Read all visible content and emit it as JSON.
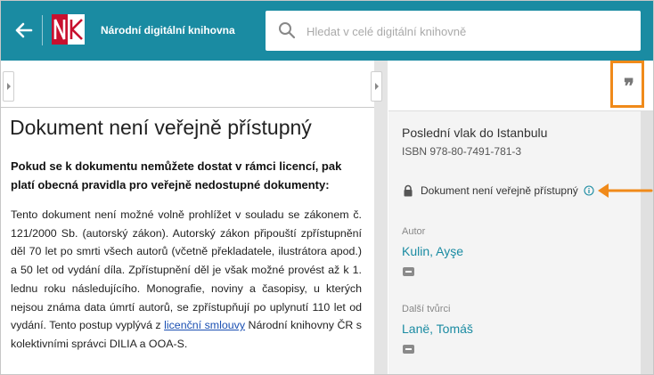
{
  "header": {
    "brand": "Národní digitální knihovna",
    "logo_text": "NK",
    "search_placeholder": "Hledat v celé digitální knihovně"
  },
  "document": {
    "title": "Dokument není veřejně přístupný",
    "intro": "Pokud se k dokumentu nemůžete dostat v rámci licencí, pak platí obecná pravidla pro veřejně nedostupné dokumenty:",
    "body_before_link": "Tento dokument není možné volně prohlížet v souladu se zákonem č. 121/2000 Sb. (autorský zákon). Autorský zákon připouští zpřístupnění děl 70 let po smrti všech autorů (včetně překladatele, ilustrátora apod.) a 50 let od vydání díla. Zpřístupnění děl je však možné provést až k 1. lednu roku následujícího. Monografie, noviny a časopisy, u kterých nejsou známa data úmrtí autorů, se zpřístupňují po uplynutí 110 let od vydání. Tento postup vyplývá z ",
    "link_text": "licenční smlouvy",
    "body_after_link": " Národní knihovny ČR s kolektivními správci DILIA a OOA-S."
  },
  "details": {
    "book_title": "Poslední vlak do Istanbulu",
    "isbn": "ISBN 978-80-7491-781-3",
    "access_status": "Dokument není veřejně přístupný",
    "author_label": "Autor",
    "author_name": "Kulin, Ayşe",
    "others_label": "Další tvůrci",
    "other_name": "Lanë, Tomáš",
    "cite_icon": "quote-icon"
  },
  "colors": {
    "header_bg": "#1a8ba2",
    "link_teal": "#1a8ba2",
    "highlight_orange": "#f08a1a"
  }
}
